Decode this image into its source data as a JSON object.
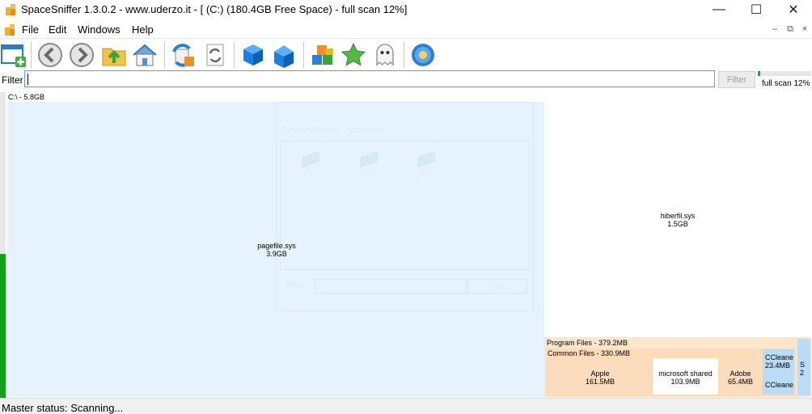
{
  "window": {
    "title": "SpaceSniffer 1.3.0.2 - www.uderzo.it - [ (C:) (180.4GB Free Space) - full scan 12%]",
    "controls": {
      "minimize": "—",
      "maximize": "☐",
      "close": "✕"
    }
  },
  "menu": {
    "items": [
      "File",
      "Edit",
      "Windows",
      "Help"
    ],
    "mdi_controls": {
      "minimize": "–",
      "restore": "⧉",
      "close": "×"
    }
  },
  "toolbar": {
    "buttons": [
      "new-window-icon",
      "back-icon",
      "forward-icon",
      "folder-up-icon",
      "home-icon",
      "refresh-icon",
      "rescan-icon",
      "blue-cube-icon",
      "blue-cube-open-icon",
      "colored-blocks-icon",
      "star-icon",
      "ghost-icon",
      "gear-flower-icon"
    ]
  },
  "filter": {
    "label": "Filter",
    "value": "",
    "button_label": "Filter"
  },
  "scan": {
    "label": "full scan 12%",
    "progress_percent": 12
  },
  "side_progress": {
    "fraction": 0.47
  },
  "map": {
    "root_label": "C:\\ - 5.8GB",
    "pagefile": {
      "name": "pagefile.sys",
      "size": "3.9GB"
    },
    "hiberfil": {
      "name": "hiberfil.sys",
      "size": "1.5GB"
    },
    "program_files": {
      "label": "Program Files - 379.2MB"
    },
    "common_files": {
      "label": "Common Files - 330.9MB"
    },
    "apple": {
      "name": "Apple",
      "size": "161.5MB"
    },
    "microsoft_shared": {
      "name": "microsoft shared",
      "size": "103.9MB"
    },
    "adobe": {
      "name": "Adobe",
      "size": "65.4MB"
    },
    "ccleaner": {
      "name": "CCleaner",
      "size": "23.4MB",
      "name2": "CCleaner"
    },
    "s_box": {
      "name": "S",
      "size": "2"
    }
  },
  "ghost_dialog": {
    "tabs": [
      "Drives or Paths",
      "Snapshots"
    ],
    "drives": [
      "(C:)",
      "(D:)",
      "(E:)"
    ],
    "path_label": "Path:",
    "start_label": "Start"
  },
  "status": {
    "text": "Master status: Scanning..."
  }
}
